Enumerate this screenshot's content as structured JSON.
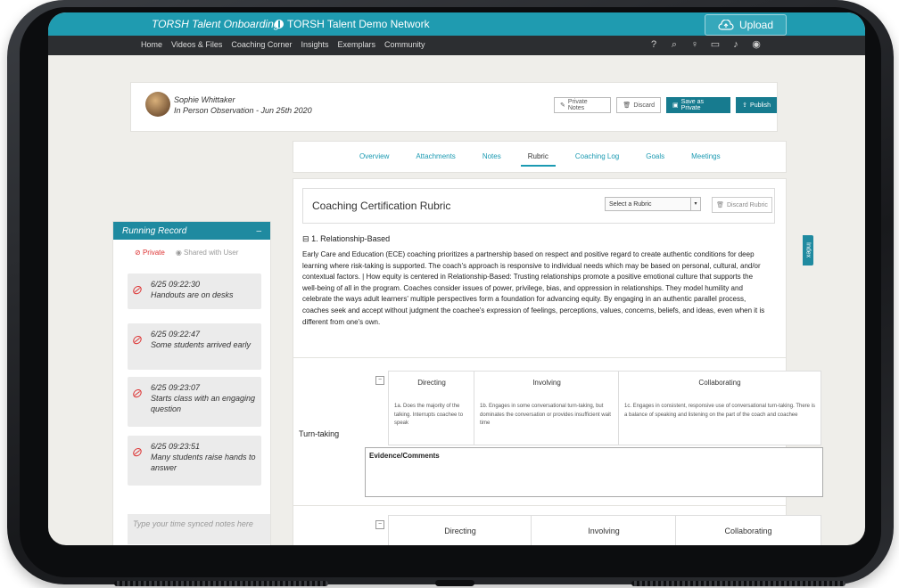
{
  "app": {
    "org": "TORSH Talent Onboarding",
    "network": "TORSH Talent Demo Network",
    "upload_label": "Upload"
  },
  "nav": {
    "items": [
      "Home",
      "Videos & Files",
      "Coaching Corner",
      "Insights",
      "Exemplars",
      "Community"
    ]
  },
  "nav_icons": [
    "help-icon",
    "search-icon",
    "lightbulb-icon",
    "calendar-icon",
    "bell-icon",
    "user-avatar-icon"
  ],
  "header": {
    "name": "Sophie Whittaker",
    "observation": "In Person Observation - Jun 25th 2020",
    "buttons": {
      "private_notes": "Private Notes",
      "discard": "Discard",
      "save_private": "Save as Private",
      "publish": "Publish"
    }
  },
  "tabs": [
    "Overview",
    "Attachments",
    "Notes",
    "Rubric",
    "Coaching Log",
    "Goals",
    "Meetings"
  ],
  "active_tab": "Rubric",
  "running_record": {
    "title": "Running Record",
    "collapse": "–",
    "private": "Private",
    "shared": "Shared with User",
    "notes": [
      {
        "time": "6/25 09:22:30",
        "text": "Handouts are on desks"
      },
      {
        "time": "6/25 09:22:47",
        "text": "Some students arrived early"
      },
      {
        "time": "6/25 09:23:07",
        "text": "Starts class with an engaging question"
      },
      {
        "time": "6/25 09:23:51",
        "text": "Many students raise hands to answer"
      }
    ],
    "input_placeholder": "Type your time synced notes here"
  },
  "rubric": {
    "title": "Coaching Certification Rubric",
    "select_label": "Select a Rubric",
    "discard_label": "Discard Rubric",
    "section_title": "1. Relationship-Based",
    "section_text": "Early Care and Education (ECE) coaching prioritizes a partnership based on respect and positive regard to create authentic conditions for deep learning where risk-taking is supported. The coach's approach is responsive to individual needs which may be based on personal, cultural, and/or contextual factors. | How equity is centered in Relationship-Based: Trusting relationships promote a positive emotional culture that supports the well-being of all in the program. Coaches consider issues of power, privilege, bias, and oppression in relationships. They model humility and celebrate the ways adult learners' multiple perspectives form a foundation for advancing equity. By engaging in an authentic parallel process, coaches seek and accept without judgment the coachee's expression of feelings, perceptions, values, concerns, beliefs, and ideas, even when it is different from one's own.",
    "row_label": "Turn-taking",
    "levels": [
      {
        "name": "Directing",
        "desc": "1a. Does the majority of the talking. Interrupts coachee to speak"
      },
      {
        "name": "Involving",
        "desc": "1b. Engages in some conversational turn-taking, but dominates the conversation or provides insufficient wait time"
      },
      {
        "name": "Collaborating",
        "desc": "1c. Engages in consistent, responsive use of conversational turn-taking. There is a balance of speaking and listening on the part of the coach and coachee"
      }
    ],
    "evidence_label": "Evidence/Comments",
    "next_levels": [
      "Directing",
      "Involving",
      "Collaborating"
    ]
  },
  "index_tab": "Index"
}
